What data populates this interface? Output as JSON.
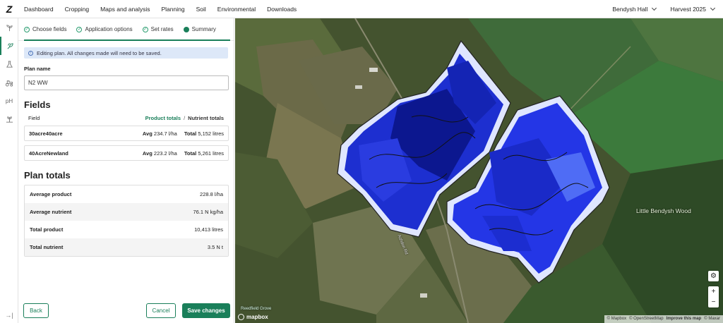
{
  "app": {
    "logo": "Z"
  },
  "nav": [
    "Dashboard",
    "Cropping",
    "Maps and analysis",
    "Planning",
    "Soil",
    "Environmental",
    "Downloads"
  ],
  "farm_selector": "Bendysh Hall",
  "harvest_selector": "Harvest 2025",
  "rail": {
    "ph_label": "pH"
  },
  "steps": [
    {
      "label": "Choose fields",
      "state": "done"
    },
    {
      "label": "Application options",
      "state": "done"
    },
    {
      "label": "Set rates",
      "state": "done"
    },
    {
      "label": "Summary",
      "state": "current"
    }
  ],
  "info_banner": "Editing plan. All changes made will need to be saved.",
  "plan_name_label": "Plan name",
  "plan_name_value": "N2 WW",
  "fields_heading": "Fields",
  "fields_table": {
    "col_field": "Field",
    "product_totals": "Product totals",
    "separator": "/",
    "nutrient_totals": "Nutrient totals",
    "rows": [
      {
        "name": "30acre40acre",
        "avg_label": "Avg",
        "avg_value": "234.7 l/ha",
        "total_label": "Total",
        "total_value": "5,152 litres"
      },
      {
        "name": "40AcreNewland",
        "avg_label": "Avg",
        "avg_value": "223.2 l/ha",
        "total_label": "Total",
        "total_value": "5,261 litres"
      }
    ]
  },
  "plan_totals_heading": "Plan totals",
  "plan_totals": [
    {
      "label": "Average product",
      "value": "228.8 l/ha"
    },
    {
      "label": "Average nutrient",
      "value": "76.1 N kg/ha"
    },
    {
      "label": "Total product",
      "value": "10,413 litres"
    },
    {
      "label": "Total nutrient",
      "value": "3.5 N t"
    }
  ],
  "buttons": {
    "back": "Back",
    "cancel": "Cancel",
    "save": "Save changes"
  },
  "map": {
    "place_label": "Little Bendysh Wood",
    "road_label": "Ashdon Rd",
    "poi_label": "Reedfield Grove",
    "mapbox_label": "mapbox",
    "attribution": [
      "© Mapbox",
      "© OpenStreetMap",
      "Improve this map",
      "© Maxar"
    ],
    "zoom_in": "+",
    "zoom_out": "−"
  }
}
